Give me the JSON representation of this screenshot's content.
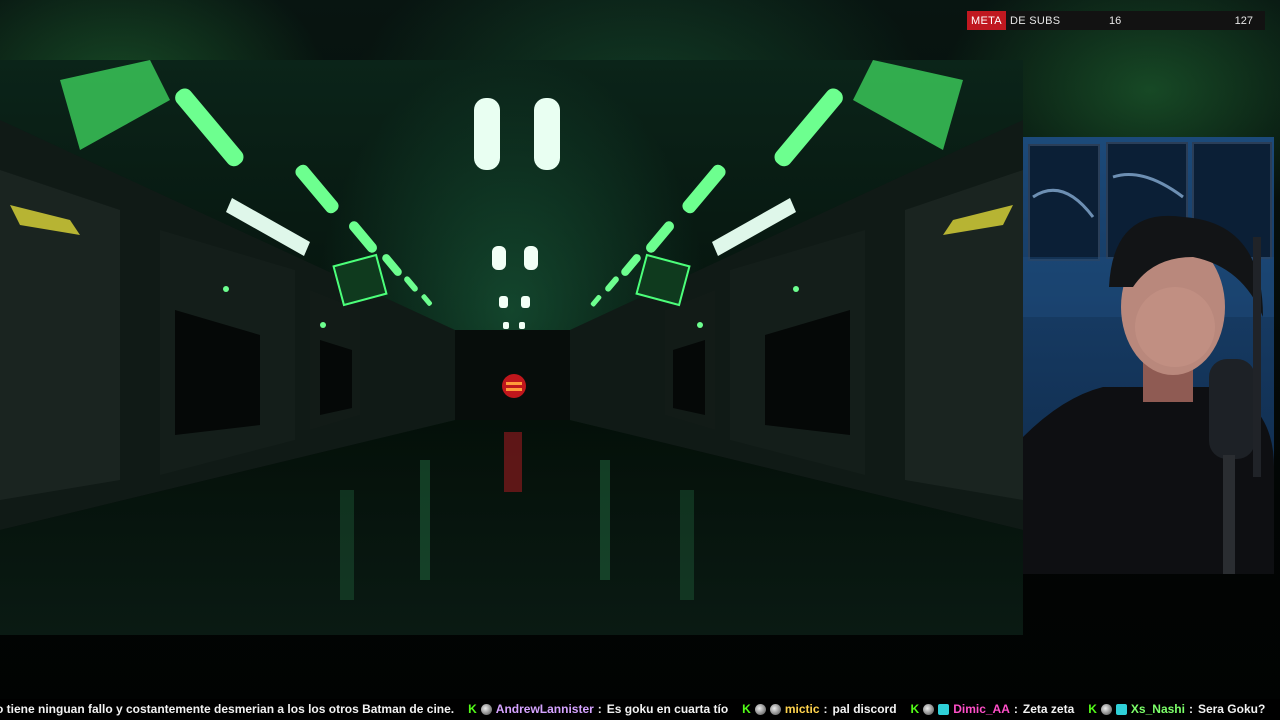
{
  "subs_goal": {
    "label_highlight": "META",
    "label_rest": "DE SUBS",
    "current": "16",
    "goal": "127",
    "accent_color": "#c01820"
  },
  "chat_ticker": {
    "platform_icon": "kick-icon",
    "platform_color": "#53fc18",
    "lead_text": "o tiene ninguan fallo y costantemente desmerian a los los otros Batman de cine.",
    "messages": [
      {
        "username": "AndrewLannister",
        "text": "Es goku en cuarta tío",
        "color": "#d5a3ff",
        "badge": "avatar-icon"
      },
      {
        "username": "mictic",
        "text": "pal discord",
        "color": "#ffd34d",
        "badge": "avatar-icon"
      },
      {
        "username": "Dimic_AA",
        "text": "Zeta zeta",
        "color": "#ff4fc8",
        "badge": "sub-badge-icon"
      },
      {
        "username": "Xs_Nashi",
        "text": "Sera Goku?",
        "color": "#7dff6a",
        "badge": "sub-badge-icon"
      }
    ]
  }
}
